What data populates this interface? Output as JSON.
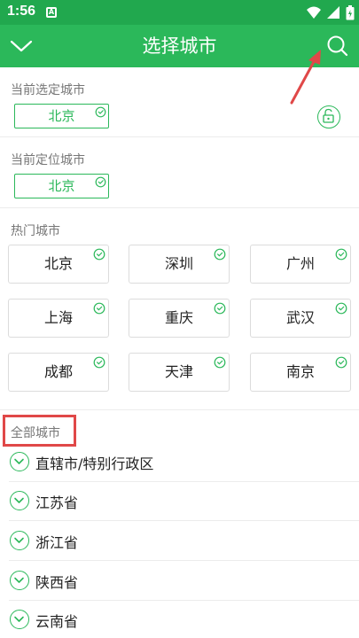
{
  "status_bar": {
    "time": "1:56",
    "notif_letter": "A"
  },
  "app_bar": {
    "title": "选择城市"
  },
  "current_selected": {
    "label": "当前选定城市",
    "city": "北京"
  },
  "current_located": {
    "label": "当前定位城市",
    "city": "北京"
  },
  "hot": {
    "label": "热门城市",
    "cities": [
      "北京",
      "深圳",
      "广州",
      "上海",
      "重庆",
      "武汉",
      "成都",
      "天津",
      "南京"
    ]
  },
  "all": {
    "label": "全部城市",
    "provinces": [
      "直辖市/特别行政区",
      "江苏省",
      "浙江省",
      "陕西省",
      "云南省"
    ]
  },
  "colors": {
    "primary": "#2bb85a",
    "status": "#21a84e",
    "highlight": "#e04848"
  }
}
